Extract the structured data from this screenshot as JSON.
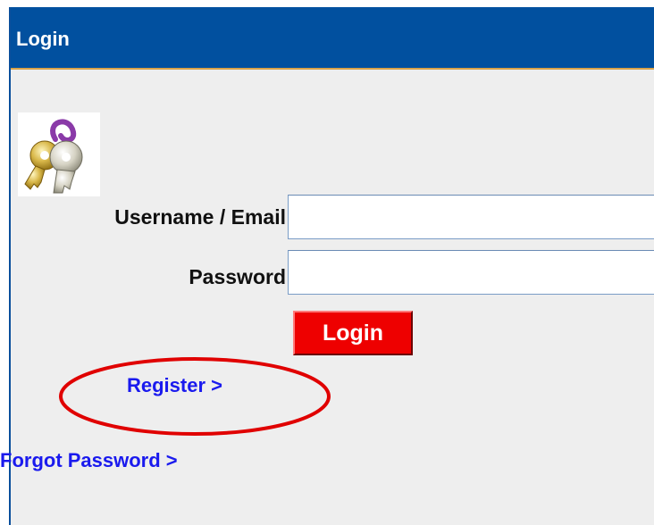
{
  "panel": {
    "title": "Login"
  },
  "form": {
    "icon": "keys-icon",
    "username_label": "Username / Email",
    "username_value": "",
    "password_label": "Password",
    "password_value": "",
    "login_button_label": "Login"
  },
  "links": {
    "register": "Register >",
    "forgot_password": "Forgot Password >"
  },
  "colors": {
    "title_bar": "#01509f",
    "panel_background": "#eeeeee",
    "login_button": "#ee0000",
    "link": "#1a1aee",
    "annotation": "#e00000"
  }
}
